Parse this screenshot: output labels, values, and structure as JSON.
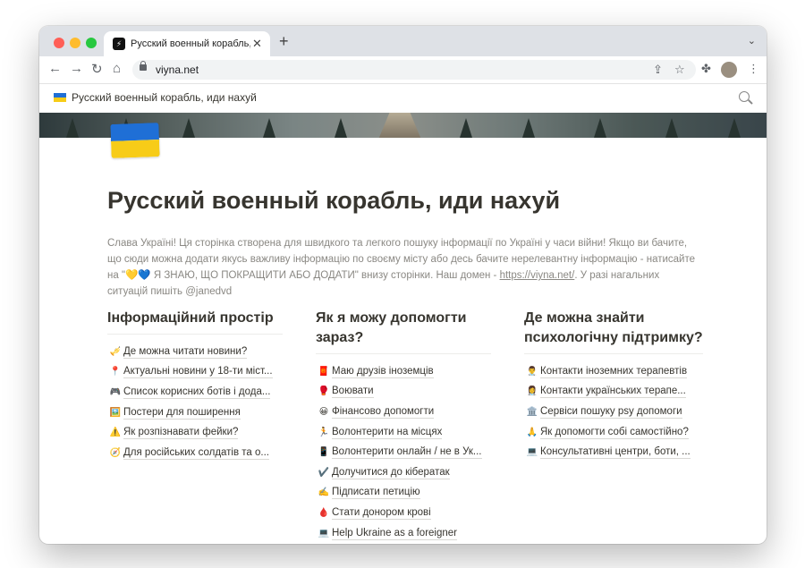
{
  "browser": {
    "tab_title": "Русский военный корабль, иди",
    "tab_favicon": "⚡",
    "url": "viyna.net"
  },
  "notion_header": {
    "breadcrumb": "Русский военный корабль, иди нахуй"
  },
  "page": {
    "title": "Русский военный корабль, иди нахуй",
    "intro": {
      "part1": "Слава Україні! Ця сторінка створена для швидкого та легкого пошуку інформації по Україні у часи війни! Якщо ви бачите, що сюди можна додати якусь важливу інформацію по своєму місту або десь бачите нерелевантну інформацію - натисайте на \"💛💙 Я ЗНАЮ, ЩО ПОКРАЩИТИ АБО ДОДАТИ\" внизу сторінки. Наш домен - ",
      "link": "https://viyna.net/",
      "part2": ". У разі нагальних ситуацій пишіть @janedvd"
    },
    "columns": [
      {
        "heading": "Інформаційний простір",
        "items": [
          {
            "icon": "🎺",
            "label": "Де можна читати новини?"
          },
          {
            "icon": "📍",
            "label": "Актуальні новини у 18-ти міст..."
          },
          {
            "icon": "🎮",
            "label": "Список корисних ботів і дода..."
          },
          {
            "icon": "🖼️",
            "label": "Постери для поширення"
          },
          {
            "icon": "⚠️",
            "label": "Як розпізнавати фейки?"
          },
          {
            "icon": "🧭",
            "label": "Для російських солдатів та о..."
          }
        ]
      },
      {
        "heading": "Як я можу допомогти зараз?",
        "items": [
          {
            "icon": "🧧",
            "label": "Маю друзів іноземців"
          },
          {
            "icon": "🥊",
            "label": "Воювати"
          },
          {
            "icon": "😀",
            "label": "Фінансово допомогти"
          },
          {
            "icon": "🏃",
            "label": "Волонтерити на місцях"
          },
          {
            "icon": "📱",
            "label": "Волонтерити онлайн / не в Ук..."
          },
          {
            "icon": "✔️",
            "label": "Долучитися до кібератак"
          },
          {
            "icon": "✍️",
            "label": "Підписати петицію"
          },
          {
            "icon": "🩸",
            "label": "Стати донором крові"
          },
          {
            "icon": "💻",
            "label": "Help Ukraine as a foreigner"
          }
        ]
      },
      {
        "heading": "Де можна знайти психологічну підтримку?",
        "items": [
          {
            "icon": "👨‍⚕️",
            "label": "Контакти іноземних терапевтів"
          },
          {
            "icon": "👩‍⚕️",
            "label": "Контакти українських терапе..."
          },
          {
            "icon": "🏛️",
            "label": "Сервіси пошуку psy допомоги"
          },
          {
            "icon": "🙏",
            "label": "Як допомогти собі самостійно?"
          },
          {
            "icon": "💻",
            "label": "Консультативні центри, боти, ..."
          }
        ]
      }
    ]
  },
  "colors": {
    "flag_blue": "#1f6fd6",
    "flag_yellow": "#f7cc18",
    "text_primary": "#37352f",
    "text_muted": "#8a8883"
  }
}
